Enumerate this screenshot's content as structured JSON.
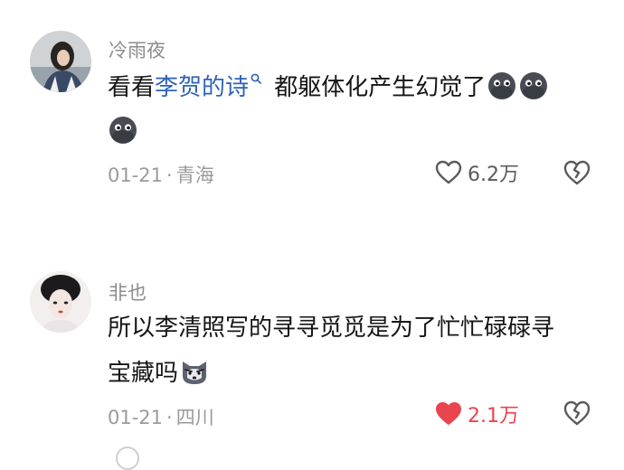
{
  "comments": [
    {
      "username": "冷雨夜",
      "text_prefix": "看看",
      "text_link": "李贺的诗",
      "text_suffix": "都躯体化产生幻觉了",
      "date": "01-21",
      "separator": "·",
      "location": "青海",
      "like_count": "6.2万",
      "liked": false,
      "emojis": [
        "dark-ball-emoji",
        "dark-ball-emoji",
        "dark-ball-emoji"
      ]
    },
    {
      "username": "非也",
      "text_line1": "所以李清照写的寻寻觅觅是为了忙忙碌碌寻",
      "text_line2": "宝藏吗",
      "date": "01-21",
      "separator": "·",
      "location": "四川",
      "like_count": "2.1万",
      "liked": true,
      "emojis": [
        "husky-emoji"
      ]
    }
  ],
  "colors": {
    "link": "#2e62b8",
    "meta": "#9b9b9b",
    "liked": "#e8454e",
    "username": "#8c8c8c"
  }
}
